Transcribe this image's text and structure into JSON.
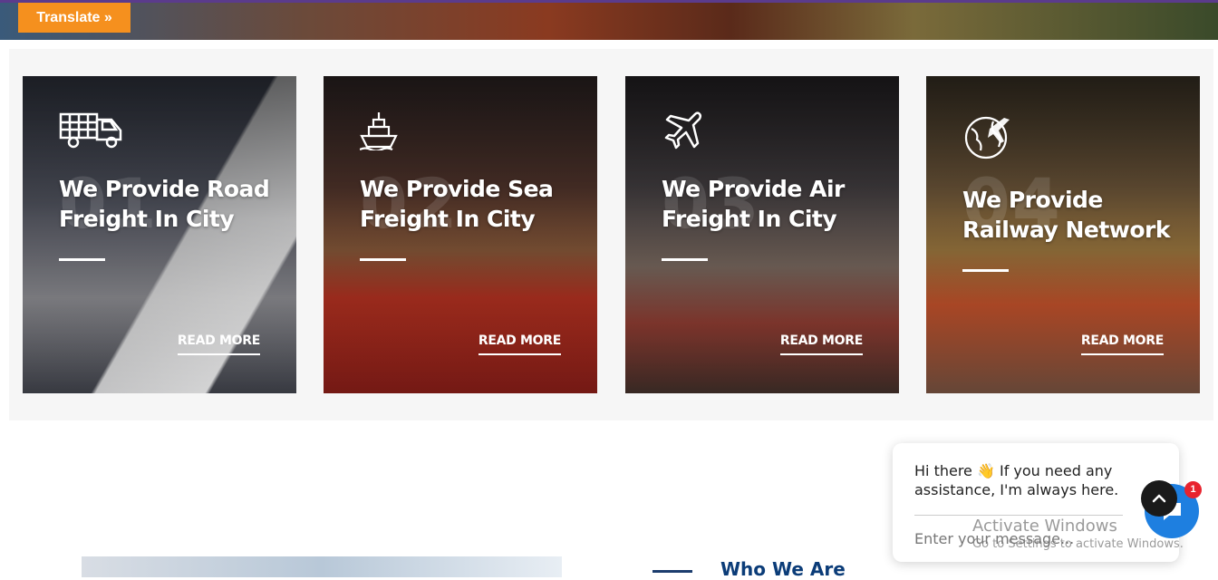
{
  "header": {
    "translate_label": "Translate »"
  },
  "services": [
    {
      "number": "01",
      "title": "We Provide Road Freight In City",
      "read_more": "READ MORE",
      "icon": "truck-icon"
    },
    {
      "number": "02",
      "title": "We Provide Sea Freight In City",
      "read_more": "READ MORE",
      "icon": "ship-icon"
    },
    {
      "number": "03",
      "title": "We Provide Air Freight In City",
      "read_more": "READ MORE",
      "icon": "airplane-icon"
    },
    {
      "number": "04",
      "title": "We Provide Railway Network",
      "read_more": "READ MORE",
      "icon": "globe-plane-icon"
    }
  ],
  "about": {
    "heading": "Who We Are"
  },
  "chat": {
    "greeting": "Hi there 👋 If you need any assistance, I'm always here.",
    "input_placeholder": "Enter your message...",
    "badge_count": "1"
  },
  "windows_watermark": {
    "title": "Activate Windows",
    "subtitle": "Go to Settings to activate Windows."
  },
  "colors": {
    "accent_orange": "#f5901e",
    "brand_navy": "#0b3c78",
    "chat_blue": "#1e7fe0",
    "badge_red": "#e8232e"
  }
}
